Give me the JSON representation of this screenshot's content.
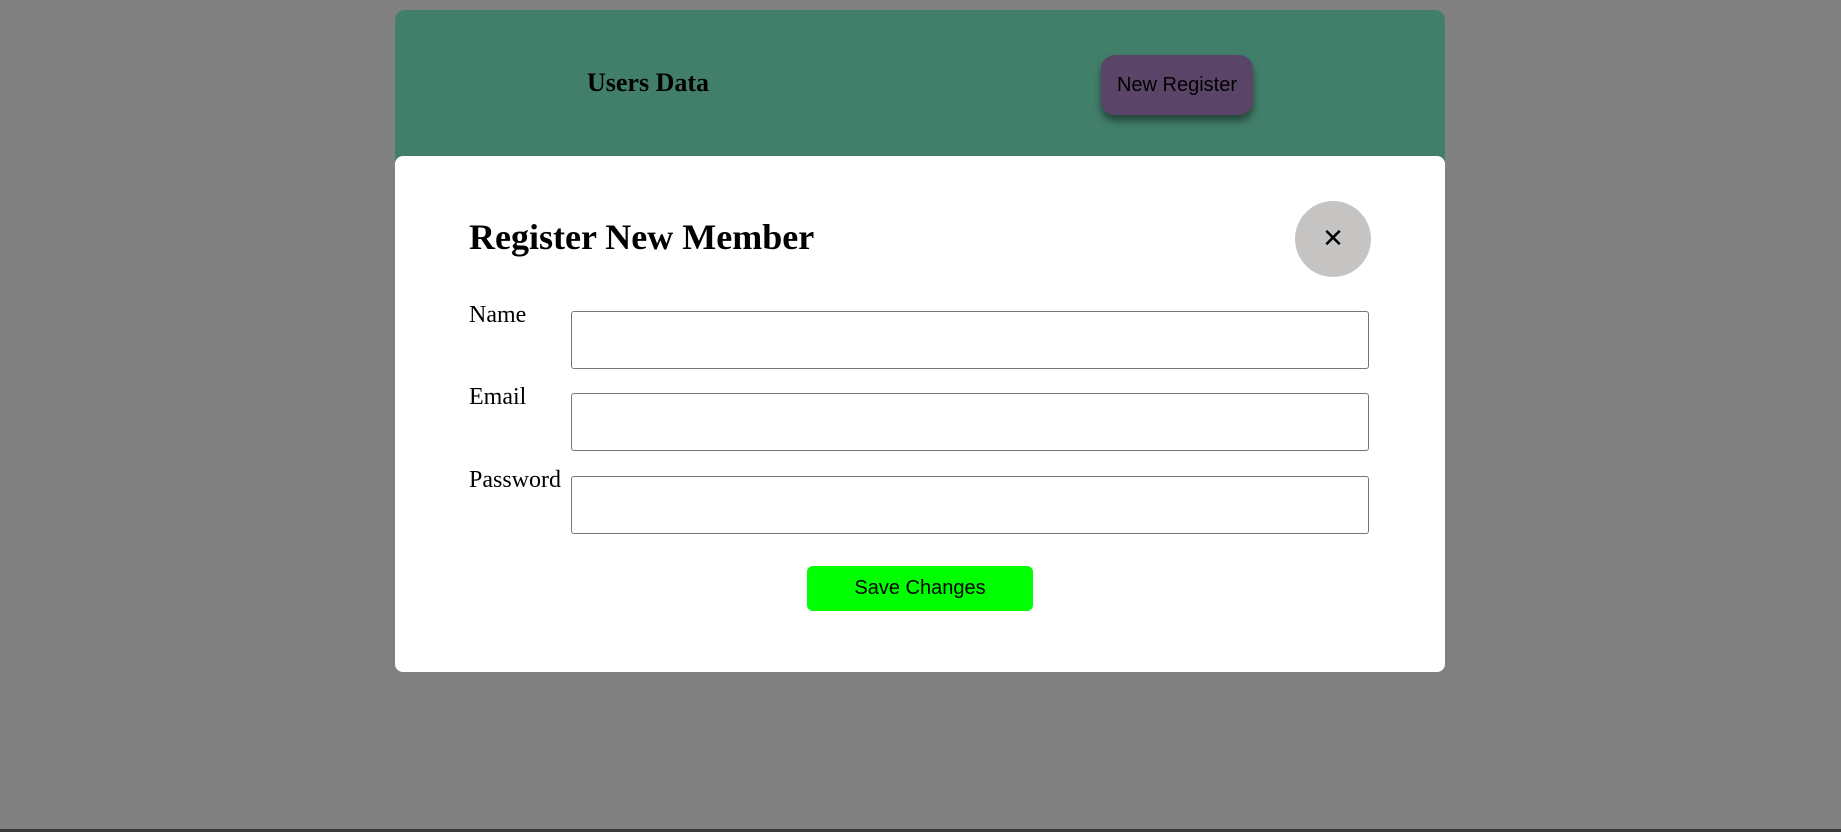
{
  "header": {
    "title": "Users Data",
    "new_register_label": "New Register"
  },
  "modal": {
    "title": "Register New Member",
    "close_icon": "close-icon",
    "close_glyph": "✕",
    "fields": [
      {
        "label": "Name",
        "value": "",
        "placeholder": ""
      },
      {
        "label": "Email",
        "value": "",
        "placeholder": ""
      },
      {
        "label": "Password",
        "value": "",
        "placeholder": ""
      }
    ],
    "save_label": "Save Changes"
  },
  "colors": {
    "backdrop": "#808080",
    "header_bg": "#417f6b",
    "new_register_bg": "#5a4467",
    "close_bg": "#c6c4c3",
    "save_bg": "#00ff00"
  }
}
